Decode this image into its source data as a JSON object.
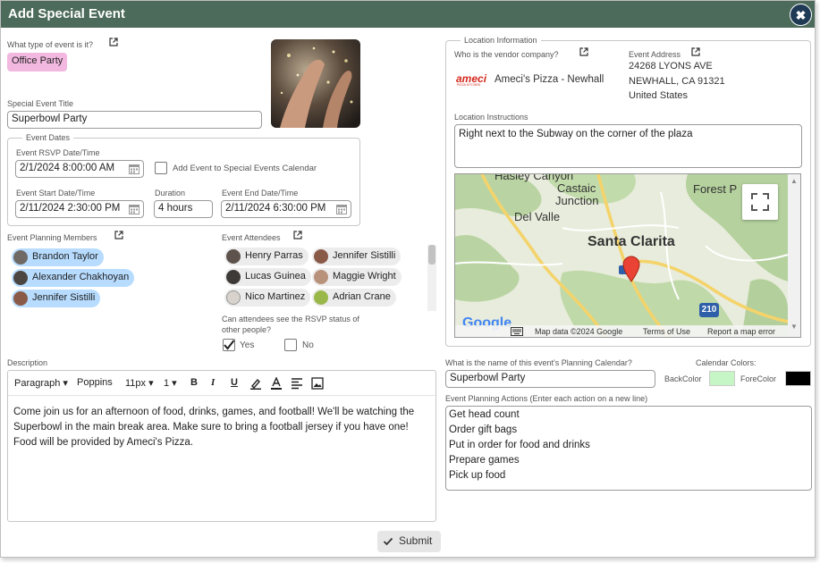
{
  "dialog": {
    "title": "Add Special Event",
    "close_label": "✖"
  },
  "event_type": {
    "label": "What type of event is it?",
    "value": "Office Party"
  },
  "event_title": {
    "label": "Special Event Title",
    "value": "Superbowl Party"
  },
  "event_dates": {
    "legend": "Event Dates",
    "rsvp_label": "Event RSVP Date/Time",
    "rsvp_value": "2/1/2024 8:00:00 AM",
    "add_to_calendar_label": "Add Event to Special Events Calendar",
    "start_label": "Event Start Date/Time",
    "start_value": "2/11/2024 2:30:00 PM",
    "duration_label": "Duration",
    "duration_value": "4 hours",
    "end_label": "Event End Date/Time",
    "end_value": "2/11/2024 6:30:00 PM"
  },
  "planning_members": {
    "label": "Event Planning Members",
    "items": [
      "Brandon Taylor",
      "Alexander Chakhoyan",
      "Jennifer Sistilli"
    ]
  },
  "attendees": {
    "label": "Event Attendees",
    "items": [
      "Henry Parras",
      "Jennifer Sistilli",
      "Lucas Guinea",
      "Maggie Wright",
      "Nico Martinez",
      "Adrian Crane"
    ]
  },
  "rsvp_visibility": {
    "question_line1": "Can attendees see the RSVP status of",
    "question_line2": "other people?",
    "yes_label": "Yes",
    "no_label": "No",
    "yes_checked": true
  },
  "description": {
    "label": "Description",
    "toolbar": {
      "format": "Paragraph",
      "font": "Poppins",
      "size": "11px",
      "line_height": "1"
    },
    "body": "Come join us for an afternoon of food, drinks, games, and football! We'll be watching the Superbowl in the main break area. Make sure to bring a football jersey if you have one! Food will be provided by Ameci's Pizza."
  },
  "submit_label": "Submit",
  "location": {
    "legend": "Location Information",
    "vendor_label": "Who is the vendor company?",
    "vendor_logo_text": "ameci",
    "vendor_logo_sub": "PIZZA KITCHEN",
    "vendor_name": "Ameci's Pizza - Newhall",
    "address_label": "Event Address",
    "address_line1": "24268 LYONS AVE",
    "address_line2": "NEWHALL, CA 91321",
    "address_line3": "United States",
    "instructions_label": "Location Instructions",
    "instructions_value": "Right next to the Subway on the corner of the plaza"
  },
  "map": {
    "places": {
      "hasley": "Hasley Canyon",
      "castaic": "Castaic",
      "junction": "Junction",
      "forest": "Forest P",
      "delvalle": "Del Valle",
      "santa_clarita": "Santa Clarita"
    },
    "highway": "210",
    "google": "Google",
    "map_data": "Map data ©2024 Google",
    "terms": "Terms of Use",
    "report": "Report a map error"
  },
  "planning_calendar": {
    "label": "What is the name of this event's Planning Calendar?",
    "value": "Superbowl Party"
  },
  "calendar_colors": {
    "label": "Calendar Colors:",
    "back_label": "BackColor",
    "fore_label": "ForeColor",
    "back_color": "#c6f5c6",
    "fore_color": "#000000"
  },
  "planning_actions": {
    "label": "Event Planning Actions (Enter each action on a new line)",
    "items": [
      "Get head count",
      "Order gift bags",
      "Put in order for food and drinks",
      "Prepare games",
      "Pick up food"
    ]
  }
}
